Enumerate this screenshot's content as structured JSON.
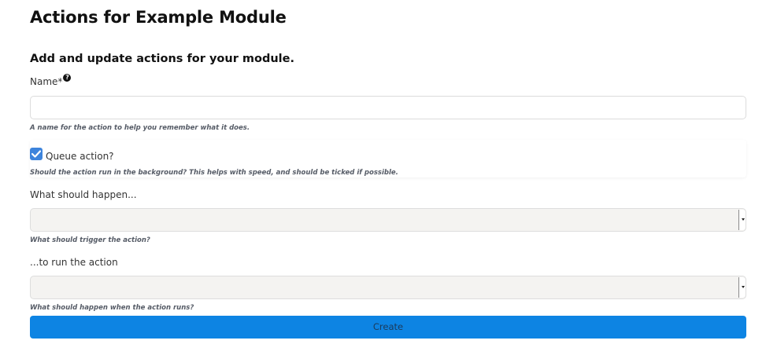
{
  "page": {
    "title": "Actions for Example Module",
    "section_title": "Add and update actions for your module."
  },
  "form": {
    "name": {
      "label": "Name",
      "required_marker": "*",
      "help_icon": "question-circle-icon",
      "value": "",
      "hint": "A name for the action to help you remember what it does."
    },
    "queue": {
      "label": "Queue action?",
      "checked": true,
      "hint": "Should the action run in the background? This helps with speed, and should be ticked if possible."
    },
    "trigger": {
      "label": "What should happen...",
      "selected": "",
      "hint": "What should trigger the action?"
    },
    "run": {
      "label": "...to run the action",
      "selected": "",
      "hint": "What should happen when the action runs?"
    },
    "submit_label": "Create"
  },
  "colors": {
    "accent": "#0d84e3",
    "checkbox": "#3d84dc",
    "select_background": "#f4f3f1"
  }
}
